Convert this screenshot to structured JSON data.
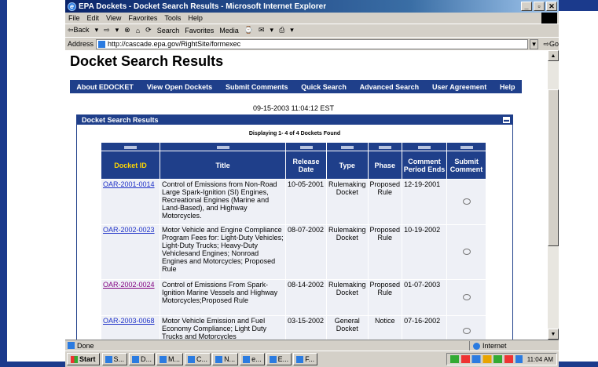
{
  "browser": {
    "title": "EPA Dockets - Docket Search Results - Microsoft Internet Explorer",
    "window_buttons": [
      "_",
      "▫",
      "✕"
    ],
    "menu": [
      "File",
      "Edit",
      "View",
      "Favorites",
      "Tools",
      "Help"
    ],
    "toolbar": [
      "⇦Back",
      "▾",
      "⇨",
      "▾",
      "⊗",
      "⌂",
      "⟳",
      "Search",
      "Favorites",
      "Media",
      "⌚",
      "✉",
      "▾",
      "⎙",
      "▾"
    ],
    "address_label": "Address",
    "address_value": "http://cascade.epa.gov/RightSite/formexec",
    "go_label": "Go",
    "status_text": "Done",
    "zone_text": "Internet"
  },
  "page": {
    "heading": "Docket Search Results",
    "nav": [
      "About EDOCKET",
      "View Open Dockets",
      "Submit Comments",
      "Quick Search",
      "Advanced Search",
      "User Agreement",
      "Help"
    ],
    "timestamp": "09-15-2003 11:04:12 EST",
    "panel_title": "Docket Search Results",
    "summary": "Displaying 1- 4 of 4 Dockets Found",
    "columns": [
      "Docket ID",
      "Title",
      "Release Date",
      "Type",
      "Phase",
      "Comment Period Ends",
      "Submit Comment"
    ],
    "rows": [
      {
        "id": "OAR-2001-0014",
        "title": "Control of Emissions from Non-Road Large Spark-Ignition (SI) Engines, Recreational Engines (Marine and Land-Based), and Highway Motorcycles.",
        "release": "10-05-2001",
        "type": "Rulemaking Docket",
        "phase": "Proposed Rule",
        "ends": "12-19-2001"
      },
      {
        "id": "OAR-2002-0023",
        "title": "Motor Vehicle and Engine Compliance Program Fees for: Light-Duty Vehicles; Light-Duty Trucks; Heavy-Duty Vehiclesand Engines; Nonroad Engines and Motorcycles; Proposed Rule",
        "release": "08-07-2002",
        "type": "Rulemaking Docket",
        "phase": "Proposed Rule",
        "ends": "10-19-2002"
      },
      {
        "id": "OAR-2002-0024",
        "title": "Control of Emissions From Spark-Ignition Marine Vessels and Highway Motorcycles;Proposed Rule",
        "release": "08-14-2002",
        "type": "Rulemaking Docket",
        "phase": "Proposed Rule",
        "ends": "01-07-2003"
      },
      {
        "id": "OAR-2003-0068",
        "title": "Motor Vehicle Emission and Fuel Economy Compliance; Light Duty Trucks and Motorcycles",
        "release": "03-15-2002",
        "type": "General Docket",
        "phase": "Notice",
        "ends": "07-16-2002"
      }
    ]
  },
  "taskbar": {
    "start_label": "Start",
    "tasks": [
      "S...",
      "D...",
      "M...",
      "C...",
      "N...",
      "e...",
      "E...",
      "F..."
    ],
    "clock": "11:04 AM"
  },
  "colors": {
    "nav_bg": "#1f3f8a",
    "link": "#1e31c8",
    "visited": "#800080",
    "header_gold": "#ffd700"
  }
}
